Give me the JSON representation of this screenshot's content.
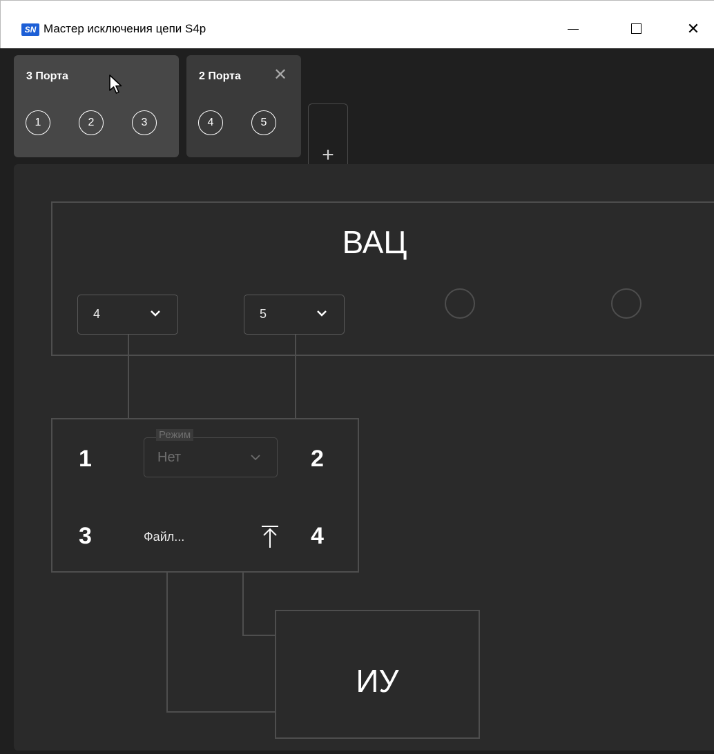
{
  "window": {
    "title": "Мастер исключения цепи S4p",
    "logo_text": "SN",
    "controls": {
      "minimize": "minimize-icon",
      "maximize": "maximize-icon",
      "close": "✕"
    }
  },
  "tabs": [
    {
      "label": "3 Порта",
      "active": true,
      "ports": [
        "1",
        "2",
        "3"
      ]
    },
    {
      "label": "2 Порта",
      "active": false,
      "closable": true,
      "close_symbol": "✕",
      "ports": [
        "4",
        "5"
      ]
    }
  ],
  "add_tab_symbol": "+",
  "diagram": {
    "vna": {
      "title": "ВАЦ",
      "port_selects": [
        {
          "value": "4"
        },
        {
          "value": "5"
        }
      ],
      "empty_ports_icon": "circle-outline"
    },
    "network": {
      "port_labels": [
        "1",
        "2",
        "3",
        "4"
      ],
      "mode": {
        "legend": "Режим",
        "value": "Нет",
        "enabled": false
      },
      "file_label": "Файл...",
      "upload_icon": "upload-icon"
    },
    "dut": {
      "title": "ИУ"
    }
  },
  "colors": {
    "background": "#1f1f1f",
    "panel": "#2a2a2a",
    "active_tab": "#474747",
    "inactive_tab": "#3a3a3a",
    "lines": "#4e4e4e",
    "logo": "#1d5fd6"
  }
}
